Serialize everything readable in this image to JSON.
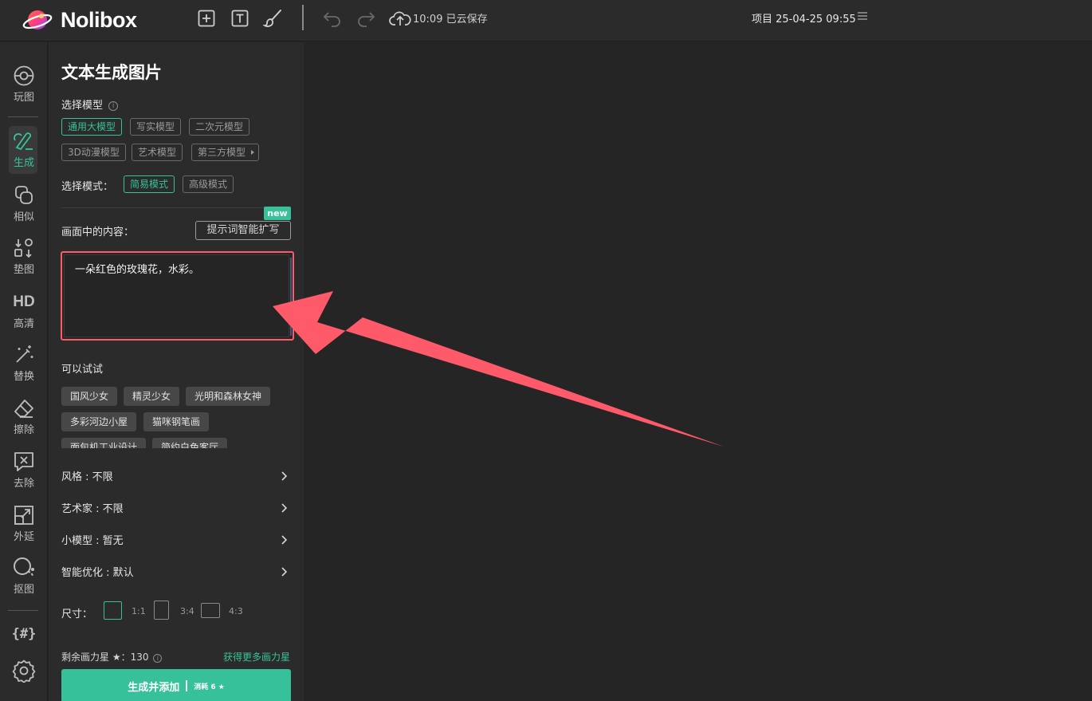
{
  "app": {
    "name": "Nolibox"
  },
  "topbar": {
    "save_status": "10:09 已云保存",
    "project": "项目 25-04-25 09:55"
  },
  "rail": {
    "items": [
      {
        "label": "玩图",
        "icon": "palette-icon"
      },
      {
        "label": "生成",
        "icon": "brush-icon",
        "active": true
      },
      {
        "label": "相似",
        "icon": "copy-icon"
      },
      {
        "label": "垫图",
        "icon": "swap-icon"
      },
      {
        "label": "高清",
        "icon": "hd-icon"
      },
      {
        "label": "替换",
        "icon": "magic-wand-icon"
      },
      {
        "label": "擦除",
        "icon": "eraser-icon"
      },
      {
        "label": "去除",
        "icon": "remove-icon"
      },
      {
        "label": "外延",
        "icon": "expand-icon"
      },
      {
        "label": "抠图",
        "icon": "cutout-icon"
      }
    ],
    "hash_label": "{#}"
  },
  "panel": {
    "title": "文本生成图片",
    "model_label": "选择模型",
    "models": [
      "通用大模型",
      "写实模型",
      "二次元模型",
      "3D动漫模型",
      "艺术模型",
      "第三方模型"
    ],
    "selected_model": "通用大模型",
    "mode_label": "选择模式：",
    "modes": [
      "简易模式",
      "高级模式"
    ],
    "selected_mode": "简易模式",
    "content_label": "画面中的内容：",
    "expand_button": "提示词智能扩写",
    "new_badge": "new",
    "prompt_text": "一朵红色的玫瑰花，水彩。",
    "try_label": "可以试试",
    "suggestions": [
      "国风少女",
      "精灵少女",
      "光明和森林女神",
      "多彩河边小屋",
      "猫咪钢笔画",
      "面包机工业设计",
      "简约白色客厅"
    ],
    "options": [
      {
        "label": "风格 : 不限"
      },
      {
        "label": "艺术家 : 不限"
      },
      {
        "label": "小模型 : 暂无"
      },
      {
        "label": "智能优化 : 默认"
      }
    ],
    "size_label": "尺寸：",
    "ratios": [
      "1:1",
      "3:4",
      "4:3"
    ],
    "selected_ratio": "1:1",
    "credits": "剩余画力星 ★：130",
    "get_more": "获得更多画力星",
    "generate_button": "生成并添加",
    "generate_cost": "消耗 6 ★"
  },
  "colors": {
    "accent": "#36c19a",
    "highlight": "#ff5a6a",
    "panel_bg": "#2b2b2b",
    "canvas_bg": "#252525"
  }
}
